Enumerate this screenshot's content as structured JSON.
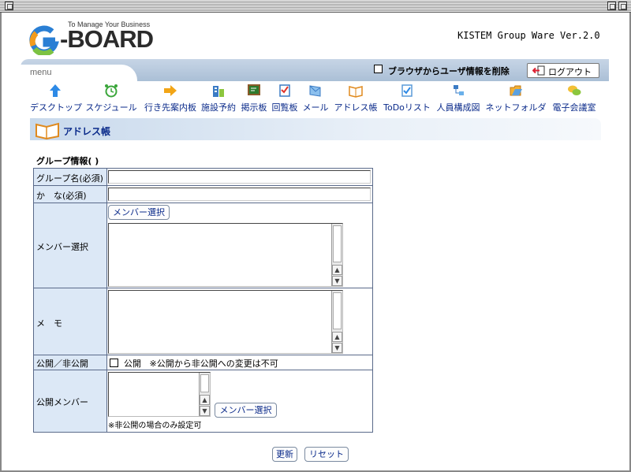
{
  "header": {
    "logo_tagline": "To Manage Your Business",
    "logo_text": "-BOARD",
    "version": "KISTEM Group Ware Ver.2.0"
  },
  "menu": {
    "label": "menu",
    "clear_user_info": {
      "label": "ブラウザからユーザ情報を削除",
      "checked": false
    },
    "logout_label": "ログアウト",
    "items": [
      {
        "label": "デスクトップ",
        "icon": "up-arrow-icon"
      },
      {
        "label": "スケジュール",
        "icon": "alarm-clock-icon"
      },
      {
        "label": "行き先案内板",
        "icon": "right-arrow-icon"
      },
      {
        "label": "施設予約",
        "icon": "building-icon"
      },
      {
        "label": "掲示板",
        "icon": "board-icon"
      },
      {
        "label": "回覧板",
        "icon": "checklist-icon"
      },
      {
        "label": "メール",
        "icon": "envelope-icon"
      },
      {
        "label": "アドレス帳",
        "icon": "book-icon"
      },
      {
        "label": "ToDoリスト",
        "icon": "todo-icon"
      },
      {
        "label": "人員構成図",
        "icon": "org-chart-icon"
      },
      {
        "label": "ネットフォルダ",
        "icon": "folder-icon"
      },
      {
        "label": "電子会議室",
        "icon": "chat-icon"
      }
    ]
  },
  "section": {
    "title": "アドレス帳"
  },
  "form": {
    "heading": "グループ情報( )",
    "group_name": {
      "label": "グループ名(必須)",
      "value": ""
    },
    "kana": {
      "label": "か　な(必須)",
      "value": ""
    },
    "members": {
      "label": "メンバー選択",
      "select_button": "メンバー選択"
    },
    "memo": {
      "label": "メ　モ"
    },
    "visibility": {
      "label": "公開／非公開",
      "checkbox_label": "公開",
      "note": "※公開から非公開への変更は不可",
      "checked": false
    },
    "public_members": {
      "label": "公開メンバー",
      "select_button": "メンバー選択",
      "note": "※非公開の場合のみ設定可"
    }
  },
  "actions": {
    "update_label": "更新",
    "reset_label": "リセット"
  },
  "colors": {
    "label_cell": "#dce8f6",
    "link_text": "#0a2a8a",
    "menu_band": "#aabfd6"
  }
}
